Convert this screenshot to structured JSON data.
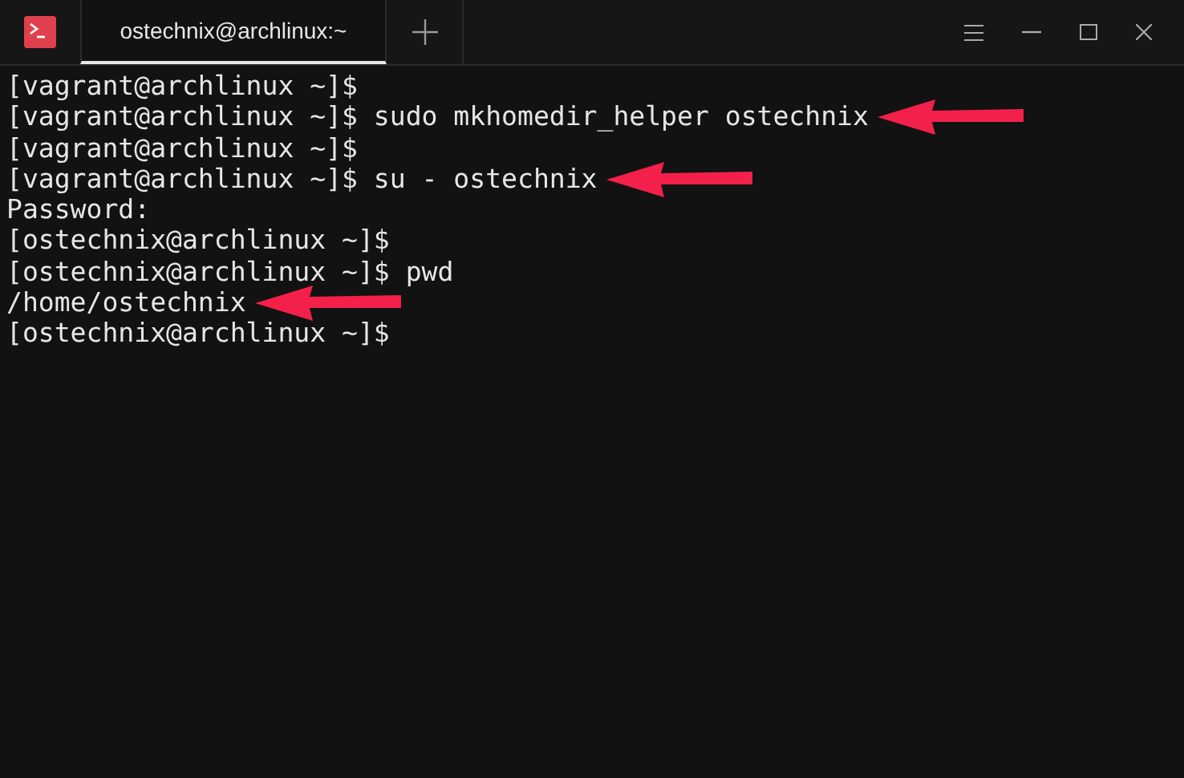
{
  "tabs": [
    {
      "label": "ostechnix@archlinux:~",
      "selected": true
    }
  ],
  "lines": [
    {
      "text": "[vagrant@archlinux ~]$",
      "arrow": false
    },
    {
      "text": "[vagrant@archlinux ~]$ sudo mkhomedir_helper ostechnix",
      "arrow": true
    },
    {
      "text": "[vagrant@archlinux ~]$",
      "arrow": false
    },
    {
      "text": "[vagrant@archlinux ~]$ su - ostechnix",
      "arrow": true
    },
    {
      "text": "Password:",
      "arrow": false
    },
    {
      "text": "[ostechnix@archlinux ~]$",
      "arrow": false
    },
    {
      "text": "[ostechnix@archlinux ~]$ pwd",
      "arrow": false
    },
    {
      "text": "/home/ostechnix",
      "arrow": true
    },
    {
      "text": "[ostechnix@archlinux ~]$",
      "arrow": false
    }
  ]
}
